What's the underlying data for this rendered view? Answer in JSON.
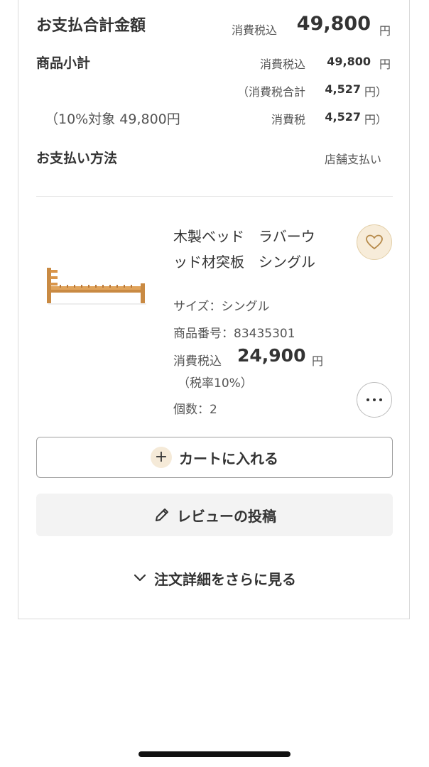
{
  "summary": {
    "total_label": "お支払合計金額",
    "total_tax_label": "消費税込",
    "total_amount": "49,800",
    "total_yen": "円",
    "subtotal_label": "商品小計",
    "subtotal_tax_label": "消費税込",
    "subtotal_amount": "49,800",
    "subtotal_yen": "円",
    "tax_total_open": "（消費税合計",
    "tax_total_amount": "4,527",
    "tax_total_close": "円）",
    "tax_target_text": "（10%対象 49,800円",
    "tax_label": "消費税",
    "tax_amount": "4,527",
    "tax_close": "円）",
    "payment_label": "お支払い方法",
    "payment_value": "店舗支払い"
  },
  "product": {
    "name_line1": "木製ベッド　ラバーウ",
    "name_line2": "ッド材突板　シングル",
    "size": "サイズ：シングル",
    "item_number": "商品番号：83435301",
    "price_tax_label": "消費税込",
    "price": "24,900",
    "price_yen": "円",
    "tax_rate": "（税率10%）",
    "quantity": "個数：2"
  },
  "actions": {
    "add_to_cart": "カートに入れる",
    "post_review": "レビューの投稿",
    "show_more_details": "注文詳細をさらに見る"
  },
  "icons": {
    "favorite": "heart-icon",
    "more": "more-horizontal-icon",
    "add": "plus-icon",
    "review": "pencil-icon",
    "expand": "chevron-down-icon"
  },
  "colors": {
    "favorite_bg": "#f7ecd9",
    "bed_wood": "#d9954a"
  }
}
